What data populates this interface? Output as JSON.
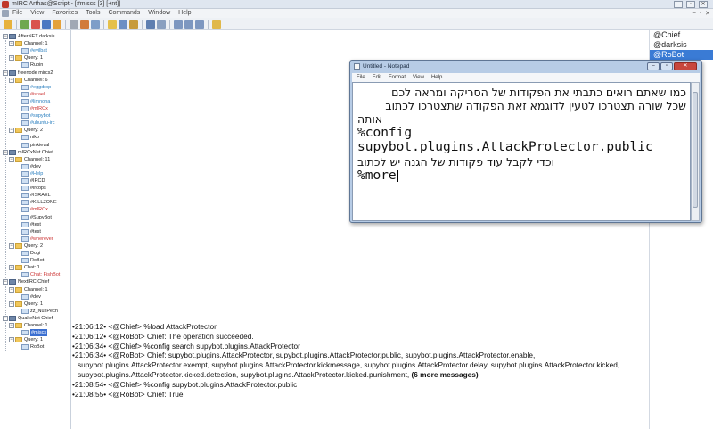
{
  "window": {
    "title": "mIRC Arthas@Script - [#miscs [3] [+nt]]",
    "controls": [
      "–",
      "▫",
      "✕"
    ]
  },
  "menubar": {
    "items": [
      "File",
      "View",
      "Favorites",
      "Tools",
      "Commands",
      "Window",
      "Help"
    ],
    "right_controls": [
      "–",
      "▫",
      "✕"
    ]
  },
  "treebar": {
    "networks": [
      {
        "label": "AfterNET darksis",
        "groups": [
          {
            "label": "Channel: 1",
            "items": [
              "#evilbat"
            ]
          },
          {
            "label": "Query: 1",
            "items": [
              "Rubin"
            ]
          }
        ]
      },
      {
        "label": "freenode mircs2",
        "groups": [
          {
            "label": "Channel: 6",
            "items": [
              "#eggdrop",
              "#israel",
              "#limnona",
              "#mIRCx",
              "#supybot",
              "#ubuntu-irc"
            ]
          },
          {
            "label": "Query: 2",
            "items": [
              "niko",
              "pinkieval"
            ]
          }
        ]
      },
      {
        "label": "mIRCxNet Chief",
        "groups": [
          {
            "label": "Channel: 11",
            "items": [
              "#dev",
              "#Help",
              "#IRCD",
              "#ircops",
              "#ISRAEL",
              "#KILLZONE",
              "#mIRCx",
              "#SupyBot",
              "#test",
              "#test",
              "#wherever"
            ]
          },
          {
            "label": "Query: 2",
            "items": [
              "Dogi",
              "RoBot"
            ]
          },
          {
            "label": "Chat: 1",
            "items": [
              "Chat: FishBot"
            ]
          }
        ]
      },
      {
        "label": "NextIRC Chief",
        "groups": [
          {
            "label": "Channel: 1",
            "items": [
              "#dev"
            ]
          },
          {
            "label": "Query: 1",
            "items": [
              "zz_NuxPech"
            ]
          }
        ]
      },
      {
        "label": "QuakeNet Chief",
        "groups": [
          {
            "label": "Channel: 1",
            "items": [
              "#miscs"
            ]
          },
          {
            "label": "Query: 1",
            "items": [
              "RoBot"
            ]
          }
        ]
      }
    ]
  },
  "chat": {
    "lines": [
      "•21:06:12• <@Chief> %load AttackProtector",
      "•21:06:12• <@RoBot> Chief: The operation succeeded.",
      "•21:06:34• <@Chief> %config search supybot.plugins.AttackProtector",
      "•21:06:34• <@RoBot> Chief: supybot.plugins.AttackProtector, supybot.plugins.AttackProtector.public, supybot.plugins.AttackProtector.enable, supybot.plugins.AttackProtector.exempt, supybot.plugins.AttackProtector.kickmessage, supybot.plugins.AttackProtector.delay, supybot.plugins.AttackProtector.kicked, supybot.plugins.AttackProtector.kicked.detection, supybot.plugins.AttackProtector.kicked.punishment,",
      "(6 more messages)",
      "•21:08:54• <@Chief> %config supybot.plugins.AttackProtector.public",
      "•21:08:55• <@RoBot> Chief: True"
    ]
  },
  "nicklist": {
    "nicks": [
      "@Chief",
      "@darksis",
      "@RoBot"
    ],
    "selected_index": 2
  },
  "notepad": {
    "title": "Untitled - Notepad",
    "menu": [
      "File",
      "Edit",
      "Format",
      "View",
      "Help"
    ],
    "lines": [
      "כמו שאתם רואים כתבתי את הפקודות של הסריקה ומראה לכם",
      "שכל שורה תצטרכו לטעין לדוגמא זאת הפקודה שתצטרכו לכתוב",
      "אותה",
      "%config",
      "supybot.plugins.AttackProtector.public",
      "וכדי לקבל עוד פקודות של הגנה יש לכתוב",
      "%more"
    ]
  },
  "colors": {
    "title_bg": "#dfe6f0",
    "selection": "#3a7bd5",
    "notepad_frame": "#b7cce6",
    "active_channel": "#cc3333",
    "highlight_channel": "#2a7fbf"
  }
}
